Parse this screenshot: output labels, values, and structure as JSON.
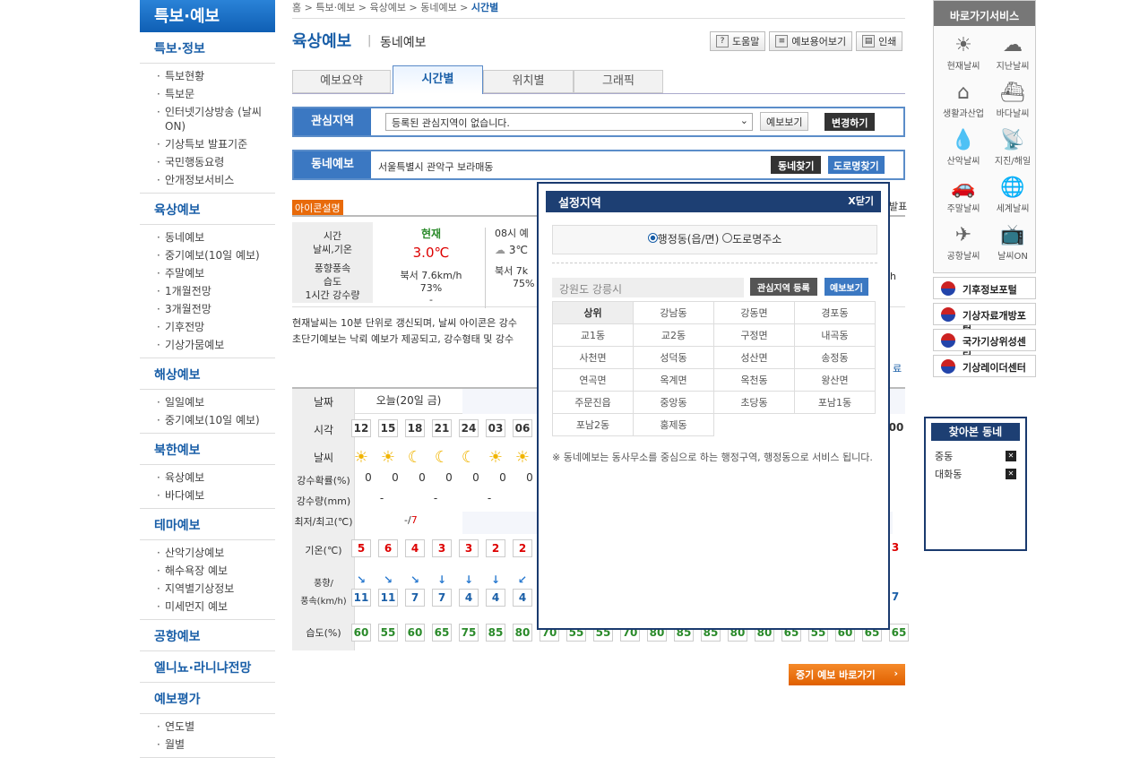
{
  "nav": {
    "top": "특보·예보",
    "sections": [
      {
        "title": "특보·정보",
        "items": [
          "특보현황",
          "특보문",
          "인터넷기상방송 (날씨ON)",
          "기상특보 발표기준",
          "국민행동요령",
          "안개정보서비스"
        ]
      },
      {
        "title": "육상예보",
        "items": [
          "동네예보",
          "중기예보(10일 예보)",
          "주말예보",
          "1개월전망",
          "3개월전망",
          "기후전망",
          "기상가뭄예보"
        ]
      },
      {
        "title": "해상예보",
        "items": [
          "일일예보",
          "중기예보(10일 예보)"
        ]
      },
      {
        "title": "북한예보",
        "items": [
          "육상예보",
          "바다예보"
        ]
      },
      {
        "title": "테마예보",
        "items": [
          "산악기상예보",
          "해수욕장 예보",
          "지역별기상정보",
          "미세먼지 예보"
        ]
      },
      {
        "title": "공항예보",
        "items": []
      },
      {
        "title": "엘니뇨·라니냐전망",
        "items": []
      },
      {
        "title": "예보평가",
        "items": [
          "연도별",
          "월별"
        ]
      }
    ]
  },
  "crumb": {
    "parts": "홈 > 특보·예보 > 육상예보 > 동네예보 > ",
    "current": "시간별"
  },
  "header": {
    "title": "육상예보",
    "sep": "|",
    "sub": "동네예보",
    "help": "도움말",
    "terms": "예보용어보기",
    "print": "인쇄"
  },
  "tabs": [
    "예보요약",
    "시간별",
    "위치별",
    "그래픽"
  ],
  "interest": {
    "label": "관심지역",
    "select": "등록된 관심지역이 없습니다.",
    "view": "예보보기",
    "change": "변경하기"
  },
  "local": {
    "label": "동네예보",
    "addr": "서울특별시 관악구 보라매동",
    "find": "동네찾기",
    "road": "도로명찾기"
  },
  "icon_desc": "아이콘설명",
  "current": {
    "h_time": "시간",
    "h_weather": "날씨,기온",
    "h_wind": "풍향풍속",
    "h_hum": "습도",
    "h_rain": "1시간 강수량",
    "now": "현재",
    "temp": "3.0℃",
    "wind": "북서 7.6km/h",
    "hum": "73%",
    "rain": "-",
    "next": "08시 예",
    "next_temp": "3℃",
    "next_wind": "북서 7k",
    "next_hum": "75%"
  },
  "notice1": "현재날씨는 10분 단위로 갱신되며, 날씨 아이콘은 강수",
  "notice2": "초단기예보는 낙뢰 예보가 제공되고, 강수형태 및 강수",
  "edge": {
    "e1": "발표",
    "e2": "h",
    "e3": "료"
  },
  "table": {
    "h_date": "날짜",
    "date": "오늘(20일 금)",
    "h_time": "시각",
    "times": [
      "12",
      "15",
      "18",
      "21",
      "24",
      "03",
      "06"
    ],
    "h_weather": "날씨",
    "h_prob": "강수확률(%)",
    "probs": [
      "0",
      "0",
      "0",
      "0",
      "0",
      "0",
      "0"
    ],
    "h_rain": "강수량(mm)",
    "rains": [
      "-",
      "-",
      "-"
    ],
    "h_minmax": "최저/최고(℃)",
    "minmax": "-/",
    "max": "7",
    "h_temp": "기온(℃)",
    "temps": [
      "5",
      "6",
      "4",
      "3",
      "3",
      "2",
      "2"
    ],
    "temp_last": "3",
    "time_last": "00",
    "h_wind": "풍향/",
    "h_wind2": "풍속(km/h)",
    "winds": [
      "11",
      "11",
      "7",
      "7",
      "4",
      "4",
      "4"
    ],
    "wind_last": "7",
    "h_hum": "습도(%)",
    "hums": [
      "60",
      "55",
      "60",
      "65",
      "75",
      "85",
      "80",
      "70",
      "55",
      "55",
      "70",
      "80",
      "85",
      "85",
      "80",
      "80",
      "65",
      "55",
      "60",
      "65",
      "65"
    ]
  },
  "mid_btn": "중기 예보 바로가기",
  "popup": {
    "title": "설정지역",
    "close": "X닫기",
    "opt1": "행정동(읍/면)",
    "opt2": "도로명주소",
    "region": "강원도 강릉시",
    "reg_btn": "관심지역 등록",
    "view_btn": "예보보기",
    "cells": [
      "상위",
      "강남동",
      "강동면",
      "경포동",
      "교1동",
      "교2동",
      "구정면",
      "내곡동",
      "사천면",
      "성덕동",
      "성산면",
      "송정동",
      "연곡면",
      "옥계면",
      "옥천동",
      "왕산면",
      "주문진읍",
      "중앙동",
      "초당동",
      "포남1동",
      "포남2동",
      "홍제동"
    ],
    "note": "※ 동네예보는 동사무소를 중심으로 하는 행정구역, 행정동으로 서비스 됩니다."
  },
  "services": {
    "title": "바로가기서비스",
    "items": [
      "현재날씨",
      "지난날씨",
      "생활과산업",
      "바다날씨",
      "산악날씨",
      "지진/해일",
      "주말날씨",
      "세계날씨",
      "공항날씨",
      "날씨ON"
    ]
  },
  "portals": [
    "기후정보포털",
    "기상자료개방포털",
    "국가기상위성센터",
    "기상레이더센터"
  ],
  "recent": {
    "title": "찾아본 동네",
    "items": [
      "중동",
      "대화동"
    ]
  }
}
